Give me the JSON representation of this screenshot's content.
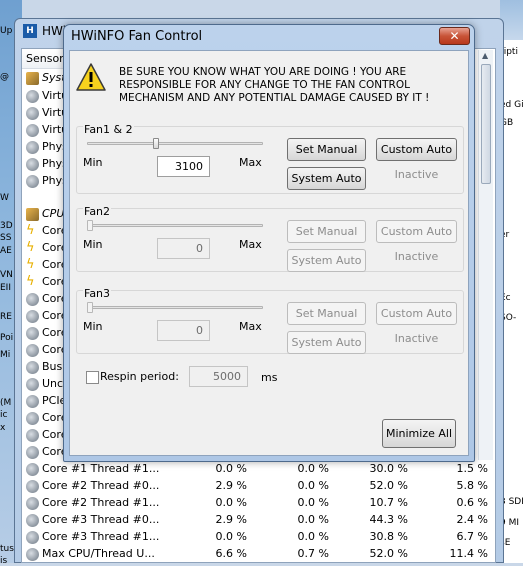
{
  "background_window": {
    "title": "HWi",
    "header_sensor": "Sensor",
    "left_edge_labels": [
      "Up",
      "@",
      "W",
      "3D",
      "SS",
      "AE",
      "VN",
      "EII",
      "RE",
      "Poi",
      "Mi",
      "(M",
      "ic",
      "x",
      "tus",
      "is",
      "Gi",
      "5"
    ],
    "right_edge_labels": [
      "ripti",
      "ed Gi",
      "GB",
      "er",
      "Ec",
      "SO-",
      "3 SDI",
      "9 MI",
      "sE"
    ],
    "sensors": [
      {
        "name": "Syst",
        "icon": "cpu-chip-icon",
        "italic": true
      },
      {
        "name": "Virtu",
        "icon": "sensor-icon"
      },
      {
        "name": "Virtu",
        "icon": "sensor-icon"
      },
      {
        "name": "Virtu",
        "icon": "sensor-icon"
      },
      {
        "name": "Phys",
        "icon": "sensor-icon"
      },
      {
        "name": "Phys",
        "icon": "sensor-icon"
      },
      {
        "name": "Phys",
        "icon": "sensor-icon"
      },
      {
        "name": "CPU",
        "icon": "cpu-chip-icon",
        "italic": true
      },
      {
        "name": "Core",
        "icon": "lightning-icon"
      },
      {
        "name": "Core",
        "icon": "lightning-icon"
      },
      {
        "name": "Core",
        "icon": "lightning-icon"
      },
      {
        "name": "Core",
        "icon": "lightning-icon"
      },
      {
        "name": "Core",
        "icon": "sensor-icon"
      },
      {
        "name": "Core",
        "icon": "sensor-icon"
      },
      {
        "name": "Core",
        "icon": "sensor-icon"
      },
      {
        "name": "Core",
        "icon": "sensor-icon"
      },
      {
        "name": "Bus C",
        "icon": "sensor-icon"
      },
      {
        "name": "Unco",
        "icon": "sensor-icon"
      },
      {
        "name": "PCIe",
        "icon": "sensor-icon"
      },
      {
        "name": "Core",
        "icon": "sensor-icon"
      },
      {
        "name": "Core",
        "icon": "sensor-icon"
      },
      {
        "name": "Core",
        "icon": "sensor-icon"
      },
      {
        "name": "Core #1 Thread #1...",
        "icon": "sensor-icon",
        "v1": "0.0 %",
        "v2": "0.0 %",
        "v3": "30.0 %",
        "v4": "1.5 %"
      },
      {
        "name": "Core #2 Thread #0...",
        "icon": "sensor-icon",
        "v1": "2.9 %",
        "v2": "0.0 %",
        "v3": "52.0 %",
        "v4": "5.8 %"
      },
      {
        "name": "Core #2 Thread #1...",
        "icon": "sensor-icon",
        "v1": "0.0 %",
        "v2": "0.0 %",
        "v3": "10.7 %",
        "v4": "0.6 %"
      },
      {
        "name": "Core #3 Thread #0...",
        "icon": "sensor-icon",
        "v1": "2.9 %",
        "v2": "0.0 %",
        "v3": "44.3 %",
        "v4": "2.4 %"
      },
      {
        "name": "Core #3 Thread #1...",
        "icon": "sensor-icon",
        "v1": "0.0 %",
        "v2": "0.0 %",
        "v3": "30.8 %",
        "v4": "6.7 %"
      },
      {
        "name": "Max CPU/Thread U...",
        "icon": "sensor-icon",
        "v1": "6.6 %",
        "v2": "0.7 %",
        "v3": "52.0 %",
        "v4": "11.4 %"
      }
    ]
  },
  "dialog": {
    "title": "HWiNFO Fan Control",
    "close_glyph": "✕",
    "warning": "BE SURE YOU KNOW WHAT YOU ARE DOING ! YOU ARE RESPONSIBLE FOR ANY CHANGE TO THE FAN CONTROL MECHANISM AND ANY POTENTIAL DAMAGE CAUSED BY IT !",
    "fans": [
      {
        "label": "Fan1 & 2",
        "min_label": "Min",
        "max_label": "Max",
        "value": "3100",
        "slider_level": 0.39,
        "enabled": true,
        "set_manual": "Set Manual",
        "custom_auto": "Custom Auto",
        "system_auto": "System Auto",
        "status": "Inactive"
      },
      {
        "label": "Fan2",
        "min_label": "Min",
        "max_label": "Max",
        "value": "0",
        "slider_level": 0.0,
        "enabled": false,
        "set_manual": "Set Manual",
        "custom_auto": "Custom Auto",
        "system_auto": "System Auto",
        "status": "Inactive"
      },
      {
        "label": "Fan3",
        "min_label": "Min",
        "max_label": "Max",
        "value": "0",
        "slider_level": 0.0,
        "enabled": false,
        "set_manual": "Set Manual",
        "custom_auto": "Custom Auto",
        "system_auto": "System Auto",
        "status": "Inactive"
      }
    ],
    "respin_label": "Respin period:",
    "respin_value": "5000",
    "respin_unit": "ms",
    "respin_checked": false,
    "minimize_all": "Minimize All"
  }
}
